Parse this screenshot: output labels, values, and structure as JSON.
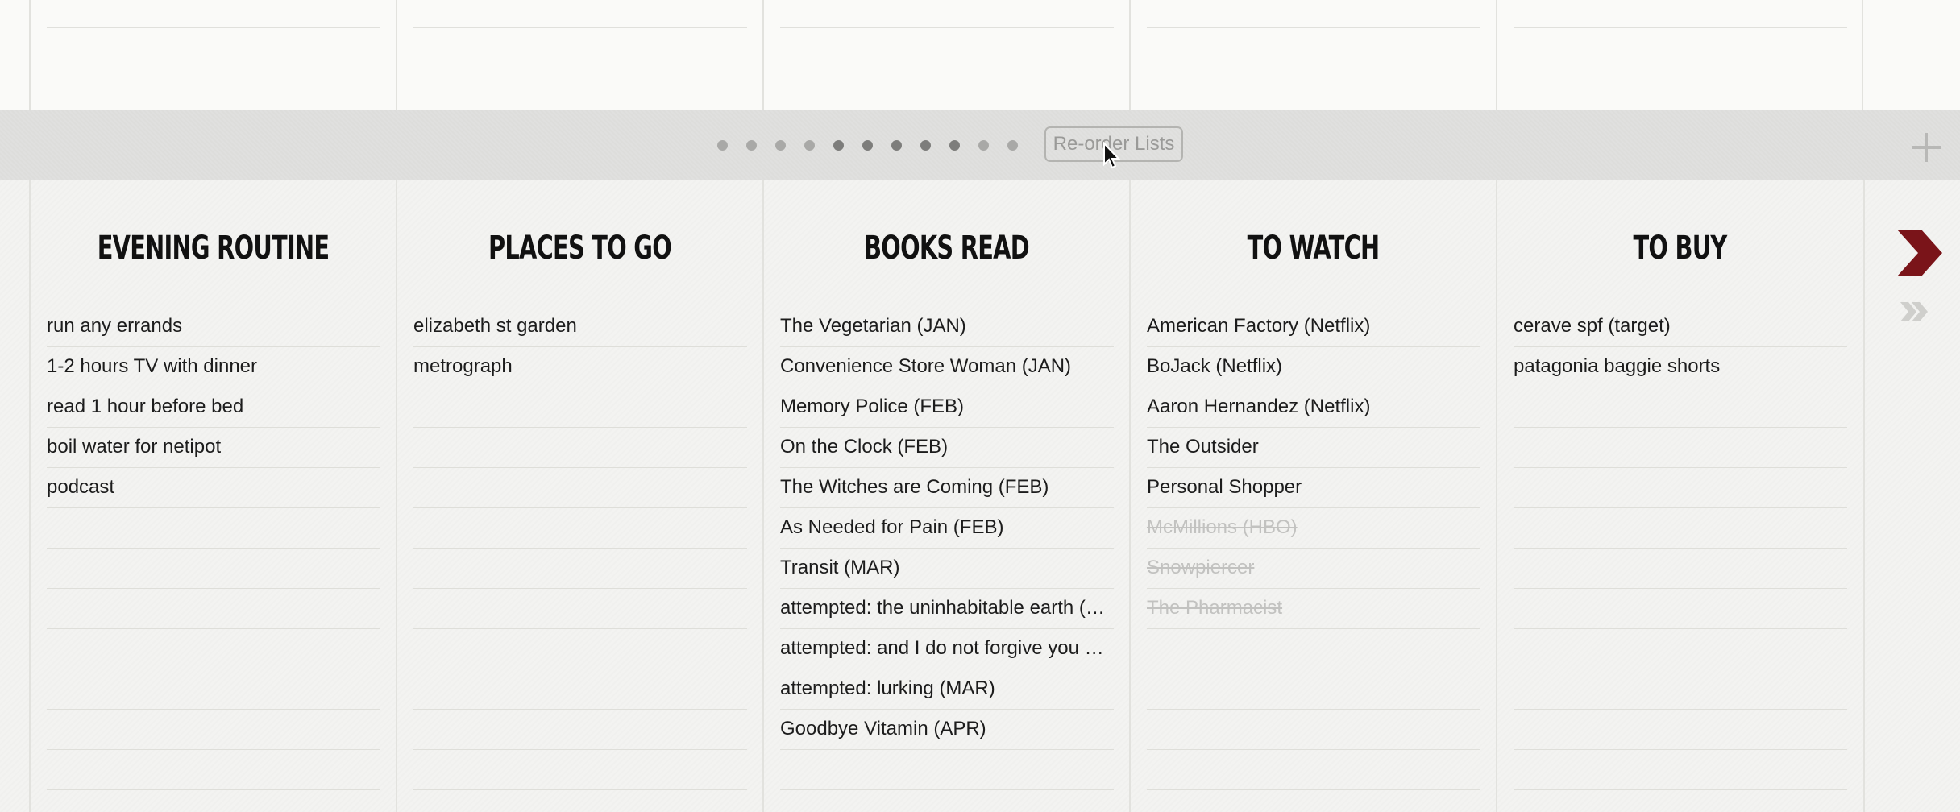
{
  "toolbar": {
    "reorder_label": "Re-order Lists",
    "page_dots_total": 11,
    "page_dots_active": [
      4,
      5,
      6,
      7,
      8
    ]
  },
  "lists": [
    {
      "title": "Evening Routine",
      "items": [
        {
          "text": "run any errands",
          "done": false
        },
        {
          "text": "1-2 hours TV with dinner",
          "done": false
        },
        {
          "text": "read 1 hour before bed",
          "done": false
        },
        {
          "text": "boil water for netipot",
          "done": false
        },
        {
          "text": "podcast",
          "done": false
        }
      ]
    },
    {
      "title": "Places to Go",
      "items": [
        {
          "text": "elizabeth st garden",
          "done": false
        },
        {
          "text": "metrograph",
          "done": false
        }
      ]
    },
    {
      "title": "Books Read",
      "items": [
        {
          "text": "The Vegetarian (JAN)",
          "done": false
        },
        {
          "text": "Convenience Store Woman (JAN)",
          "done": false
        },
        {
          "text": "Memory Police (FEB)",
          "done": false
        },
        {
          "text": "On the Clock (FEB)",
          "done": false
        },
        {
          "text": "The Witches are Coming (FEB)",
          "done": false
        },
        {
          "text": "As Needed for Pain (FEB)",
          "done": false
        },
        {
          "text": "Transit (MAR)",
          "done": false
        },
        {
          "text": "attempted: the uninhabitable earth (…",
          "done": false
        },
        {
          "text": "attempted: and I do not forgive you …",
          "done": false
        },
        {
          "text": "attempted: lurking (MAR)",
          "done": false
        },
        {
          "text": "Goodbye Vitamin (APR)",
          "done": false
        }
      ]
    },
    {
      "title": "To Watch",
      "items": [
        {
          "text": "American Factory (Netflix)",
          "done": false
        },
        {
          "text": "BoJack (Netflix)",
          "done": false
        },
        {
          "text": "Aaron Hernandez (Netflix)",
          "done": false
        },
        {
          "text": "The Outsider",
          "done": false
        },
        {
          "text": "Personal Shopper",
          "done": false
        },
        {
          "text": "McMillions (HBO)",
          "done": true
        },
        {
          "text": "Snowpiercer",
          "done": true
        },
        {
          "text": "The Pharmacist",
          "done": true
        }
      ]
    },
    {
      "title": "To Buy",
      "items": [
        {
          "text": "cerave spf (target)",
          "done": false
        },
        {
          "text": "patagonia baggie shorts",
          "done": false
        }
      ]
    }
  ],
  "nav": {
    "next_icon": "chevron-right-icon",
    "skip_icon": "double-chevron-right-icon",
    "accent_color": "#7a1419"
  }
}
